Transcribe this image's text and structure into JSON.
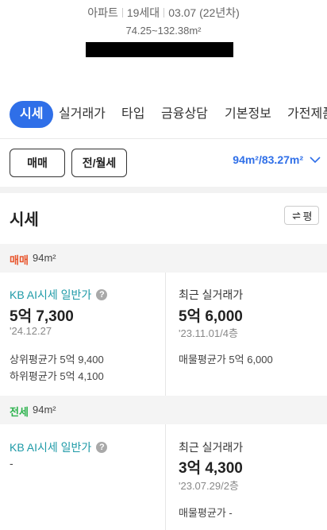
{
  "header": {
    "type": "아파트",
    "households": "19세대",
    "built": "03.07 (22년차)",
    "area_range": "74.25~132.38m²"
  },
  "tabs": [
    {
      "label": "시세",
      "active": true
    },
    {
      "label": "실거래가",
      "active": false
    },
    {
      "label": "타입",
      "active": false
    },
    {
      "label": "금융상담",
      "active": false
    },
    {
      "label": "기본정보",
      "active": false
    },
    {
      "label": "가전제품",
      "active": false
    }
  ],
  "filters": {
    "sale_button": "매매",
    "lease_button": "전/월세",
    "area_selected": "94m²/83.27m²"
  },
  "section": {
    "title": "시세",
    "unit_toggle": "평"
  },
  "sale": {
    "type_label": "매매",
    "size": "94m²",
    "kb_label": "KB AI시세 일반가",
    "kb_price": "5억 7,300",
    "kb_date": "'24.12.27",
    "upper_avg": "상위평균가 5억 9,400",
    "lower_avg": "하위평균가 5억 4,100",
    "recent_label": "최근 실거래가",
    "recent_price": "5억 6,000",
    "recent_date": "'23.11.01/4층",
    "listing_avg": "매물평균가 5억 6,000"
  },
  "lease": {
    "type_label": "전세",
    "size": "94m²",
    "kb_label": "KB AI시세 일반가",
    "kb_price": "-",
    "recent_label": "최근 실거래가",
    "recent_price": "3억 4,300",
    "recent_date": "'23.07.29/2층",
    "listing_avg": "매물평균가 -"
  },
  "colors": {
    "accent": "#2f6fe8",
    "sale": "#e8542b",
    "lease": "#2bb24c",
    "kb": "#1e9aa7"
  }
}
